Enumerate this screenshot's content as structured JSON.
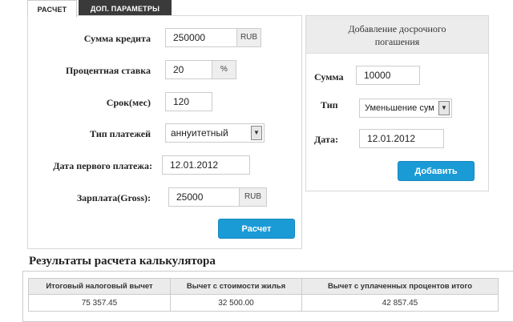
{
  "tabs": {
    "active_label": "Расчет",
    "inactive_label": "Доп. параметры"
  },
  "credit_form": {
    "amount": {
      "label": "Сумма кредита",
      "value": "250000",
      "unit": "RUB"
    },
    "rate": {
      "label": "Процентная ставка",
      "value": "20",
      "unit": "%"
    },
    "term": {
      "label": "Срок(мес)",
      "value": "120"
    },
    "payment_type": {
      "label": "Тип платежей",
      "value": "аннуитетный"
    },
    "first_payment_date": {
      "label": "Дата первого платежа:",
      "value": "12.01.2012"
    },
    "salary": {
      "label": "Зарплата(Gross):",
      "value": "25000",
      "unit": "RUB"
    },
    "calculate_label": "Расчет"
  },
  "prepayment": {
    "title_line1": "Добавление досрочного",
    "title_line2": "погашения",
    "amount": {
      "label": "Сумма",
      "value": "10000"
    },
    "type": {
      "label": "Тип",
      "value": "Уменьшение сум"
    },
    "date": {
      "label": "Дата:",
      "value": "12.01.2012"
    },
    "add_label": "Добавить"
  },
  "results": {
    "title": "Результаты расчета калькулятора",
    "columns": [
      "Итоговый налоговый вычет",
      "Вычет с стоимости жилья",
      "Вычет с уплаченных процентов итого"
    ],
    "row": [
      "75 357.45",
      "32 500.00",
      "42 857.45"
    ]
  },
  "colors": {
    "accent": "#1a9bd6",
    "inactive_tab": "#3a3a3a"
  },
  "icons": {
    "select_arrow": "chevron-down-icon"
  }
}
